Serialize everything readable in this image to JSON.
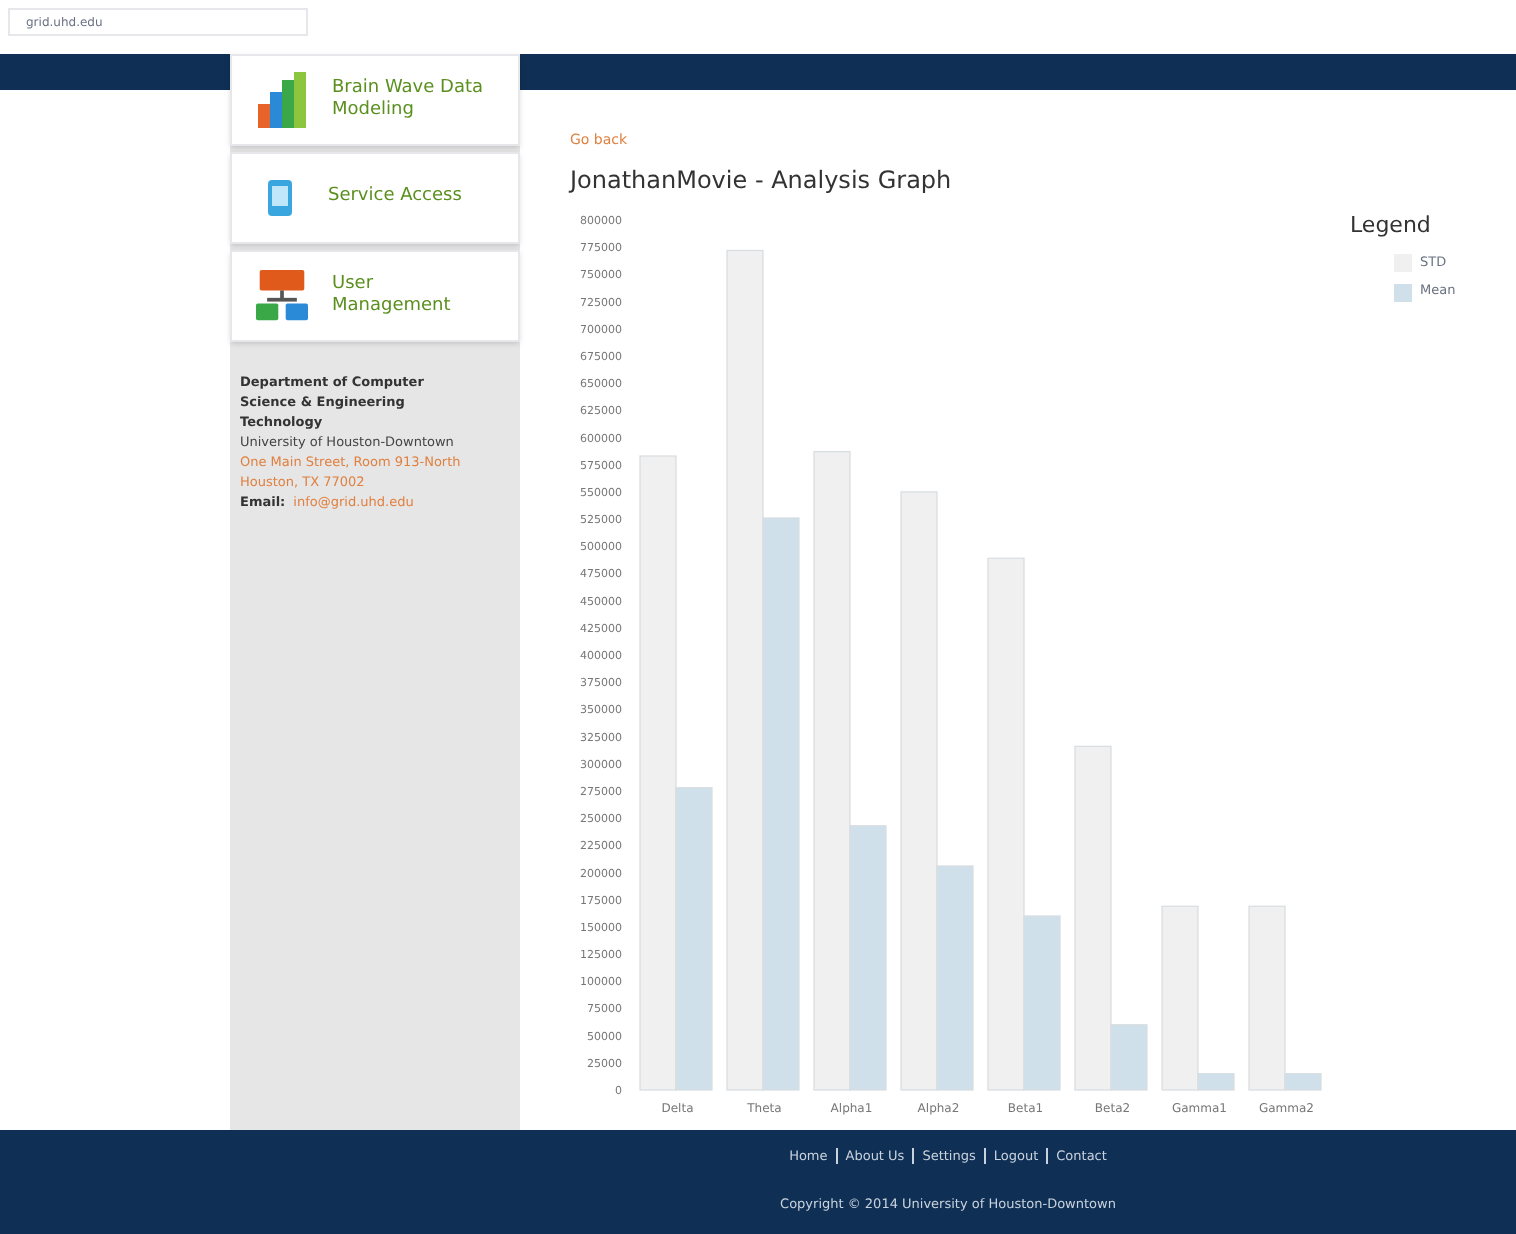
{
  "browser": {
    "url": "grid.uhd.edu"
  },
  "sidebar": {
    "items": [
      {
        "label": "Brain Wave Data Modeling",
        "kind": "chart"
      },
      {
        "label": "Service Access",
        "kind": "phone"
      },
      {
        "label": "User Management",
        "kind": "network"
      }
    ],
    "contact": {
      "department": "Department of Computer Science & Engineering Technology",
      "university": "University of Houston-Downtown",
      "street": "One Main Street, Room 913-North",
      "city": "Houston, TX 77002",
      "email_label": "Email:",
      "email": "info@grid.uhd.edu"
    }
  },
  "content": {
    "back_link": "Go back",
    "title": "JonathanMovie - Analysis Graph",
    "chart_data": {
      "type": "bar",
      "categories": [
        "Delta",
        "Theta",
        "Alpha1",
        "Alpha2",
        "Beta1",
        "Beta2",
        "Gamma1",
        "Gamma2"
      ],
      "series": [
        {
          "name": "STD",
          "color": "#f0f0f0",
          "values": [
            583000,
            772000,
            587000,
            550000,
            489000,
            316000,
            169000,
            169000
          ]
        },
        {
          "name": "Mean",
          "color": "#cfe0ea",
          "values": [
            278000,
            526000,
            243000,
            206000,
            160000,
            60000,
            15000,
            15000
          ]
        }
      ],
      "ylim": [
        0,
        800000
      ],
      "yticks": [
        0,
        25000,
        50000,
        75000,
        100000,
        125000,
        150000,
        175000,
        200000,
        225000,
        250000,
        275000,
        300000,
        325000,
        350000,
        375000,
        400000,
        425000,
        450000,
        475000,
        500000,
        525000,
        550000,
        575000,
        600000,
        625000,
        650000,
        675000,
        700000,
        725000,
        750000,
        775000,
        800000
      ]
    },
    "legend_title": "Legend"
  },
  "footer": {
    "links": [
      "Home",
      "About Us",
      "Settings",
      "Logout",
      "Contact"
    ],
    "copyright": "Copyright © 2014 University of Houston-Downtown"
  }
}
